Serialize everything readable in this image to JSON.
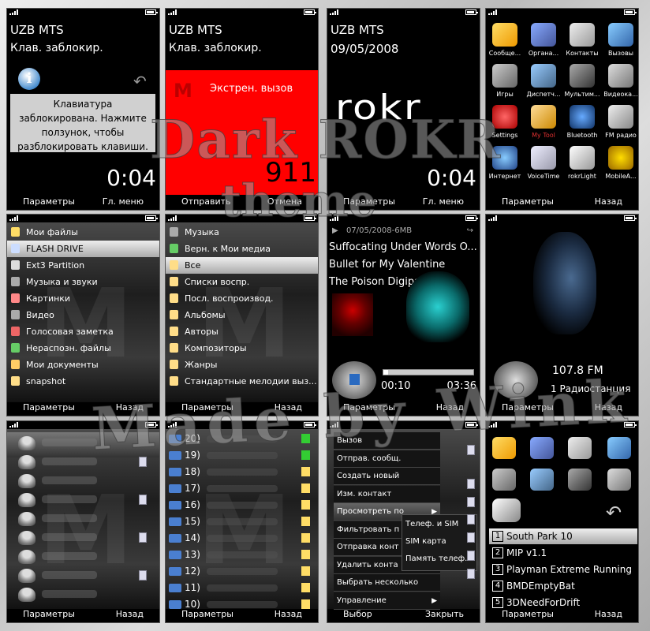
{
  "overlay": {
    "line1": "Dark ROKR",
    "line2": "theme",
    "line3": "Made by Wink"
  },
  "s1": {
    "operator": "UZB MTS",
    "subtitle": "Клав. заблокир.",
    "message": "Клавиатура заблокирована. Нажмите ползунок, чтобы разблокировать клавиши.",
    "time": "0:04",
    "left_soft": "Параметры",
    "right_soft": "Гл. меню"
  },
  "s2": {
    "operator": "UZB MTS",
    "subtitle": "Клав. заблокир.",
    "emergency": "Экстрен. вызов",
    "number": "911",
    "left_soft": "Отправить",
    "right_soft": "Отмена"
  },
  "s3": {
    "operator": "UZB MTS",
    "date": "09/05/2008",
    "logo": "ROKR",
    "time": "0:04",
    "left_soft": "Параметры",
    "right_soft": "Гл. меню"
  },
  "s4": {
    "apps": [
      {
        "label": "Сообще..."
      },
      {
        "label": "Органа..."
      },
      {
        "label": "Контакты"
      },
      {
        "label": "Вызовы"
      },
      {
        "label": "Игры"
      },
      {
        "label": "Диспетч..."
      },
      {
        "label": "Мультим..."
      },
      {
        "label": "Видеока..."
      },
      {
        "label": "Settings"
      },
      {
        "label": "My Tool"
      },
      {
        "label": "Bluetooth"
      },
      {
        "label": "FM радио"
      },
      {
        "label": "Интернет"
      },
      {
        "label": "VoiceTime"
      },
      {
        "label": "rokrLight"
      },
      {
        "label": "MobileA..."
      }
    ],
    "highlight_color": "#e03030",
    "left_soft": "Параметры",
    "right_soft": "Назад"
  },
  "s5": {
    "items": [
      {
        "label": "Мои файлы"
      },
      {
        "label": "FLASH DRIVE"
      },
      {
        "label": "Ext3 Partition"
      },
      {
        "label": "Музыка и звуки"
      },
      {
        "label": "Картинки"
      },
      {
        "label": "Видео"
      },
      {
        "label": "Голосовая заметка"
      },
      {
        "label": "Нераспозн. файлы"
      },
      {
        "label": "Мои документы"
      },
      {
        "label": "snapshot"
      }
    ],
    "left_soft": "Параметры",
    "right_soft": "Назад"
  },
  "s6": {
    "items": [
      {
        "label": "Музыка"
      },
      {
        "label": "Верн. к Мои медиа"
      },
      {
        "label": "Все"
      },
      {
        "label": "Списки воспр."
      },
      {
        "label": "Посл. воспроизвод."
      },
      {
        "label": "Альбомы"
      },
      {
        "label": "Авторы"
      },
      {
        "label": "Композиторы"
      },
      {
        "label": "Жанры"
      },
      {
        "label": "Стандартные мелодии выз..."
      }
    ],
    "left_soft": "Параметры",
    "right_soft": "Назад"
  },
  "s7": {
    "header": "07/05/2008-6MB",
    "track": "Suffocating Under Words O...",
    "artist": "Bullet for My Valentine",
    "album": "The Poison Digipa",
    "elapsed": "00:10",
    "duration": "03:36",
    "progress": 0.05,
    "left_soft": "Параметры",
    "right_soft": "Назад"
  },
  "s8": {
    "frequency": "107.8 FM",
    "station": "1 Радиостанция",
    "left_soft": "Параметры",
    "right_soft": "Назад"
  },
  "s9": {
    "left_soft": "Параметры",
    "right_soft": "Назад"
  },
  "s10": {
    "calls": [
      "20)",
      "19)",
      "18)",
      "17)",
      "16)",
      "15)",
      "14)",
      "13)",
      "12)",
      "11)",
      "10)"
    ],
    "left_soft": "Параметры",
    "right_soft": "Назад"
  },
  "s11": {
    "menu": [
      {
        "label": "Вызов"
      },
      {
        "label": "Отправ. сообщ."
      },
      {
        "label": "Создать новый"
      },
      {
        "label": "Изм. контакт"
      },
      {
        "label": "Просмотреть по"
      },
      {
        "label": "Фильтровать п"
      },
      {
        "label": "Отправка конт"
      },
      {
        "label": "Удалить конта"
      },
      {
        "label": "Выбрать несколько"
      },
      {
        "label": "Управление"
      }
    ],
    "submenu": [
      {
        "label": "Телеф. и SIM"
      },
      {
        "label": "SIM карта"
      },
      {
        "label": "Память телеф."
      }
    ],
    "left_soft": "Выбор",
    "right_soft": "Закрыть"
  },
  "s12": {
    "games": [
      {
        "num": "1",
        "label": "South Park 10"
      },
      {
        "num": "2",
        "label": "MIP v1.1"
      },
      {
        "num": "3",
        "label": "Playman Extreme Running"
      },
      {
        "num": "4",
        "label": "BMDEmptyBat"
      },
      {
        "num": "5",
        "label": "3DNeedForDrift"
      }
    ],
    "left_soft": "Параметры",
    "right_soft": "Назад"
  }
}
